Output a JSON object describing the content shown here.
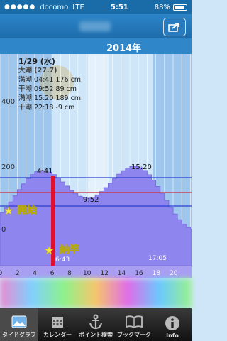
{
  "status": {
    "carrier": "docomo",
    "network": "LTE",
    "time": "5:51",
    "battery": "88%",
    "battery_level": 0.88
  },
  "header": {
    "year": "2014年"
  },
  "day_info": {
    "date": "1/29 (水)",
    "tide_name": "大潮 (27.7)",
    "rows": [
      "満潮 04:41 176 cm",
      "干潮 09:52 89 cm",
      "満潮 15:20 189 cm",
      "干潮 22:18 -9 cm"
    ]
  },
  "graph": {
    "y_ticks": [
      "400",
      "200",
      "0"
    ],
    "x_ticks": [
      "0",
      "2",
      "4",
      "6",
      "8",
      "10",
      "12",
      "14",
      "16",
      "18",
      "20"
    ],
    "peak1_label": "4:41",
    "trough_label": "9:52",
    "peak2_label": "15:20",
    "sunrise_label": "6:43",
    "sunset_label": "17:05",
    "annotation_start": "開始",
    "annotation_end": "納竿",
    "colors": {
      "sky": "#cfe6f8",
      "night": "#9fc6ec",
      "tide_fill": "#8f85ee",
      "marker": "#e0102e",
      "annotation": "#f5e83c"
    }
  },
  "tabs": [
    {
      "label": "タイドグラフ",
      "icon": "picture-icon"
    },
    {
      "label": "カレンダー",
      "icon": "calendar-icon"
    },
    {
      "label": "ポイント検索",
      "icon": "anchor-icon"
    },
    {
      "label": "ブックマーク",
      "icon": "book-icon"
    },
    {
      "label": "Info",
      "icon": "info-icon"
    }
  ]
}
